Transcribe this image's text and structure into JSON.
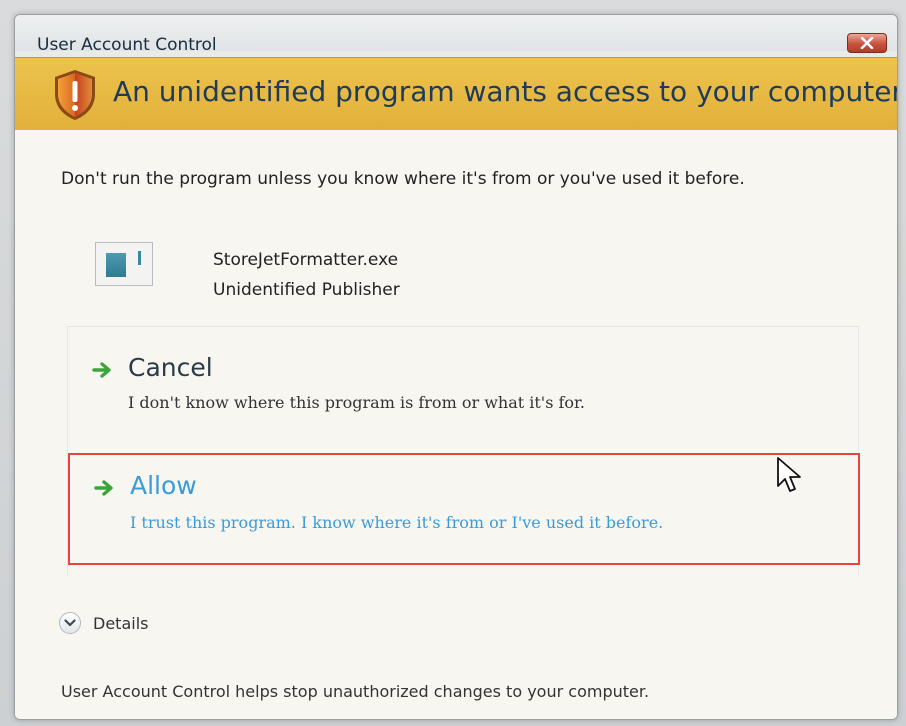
{
  "window": {
    "title": "User Account Control"
  },
  "banner": {
    "heading": "An unidentified program wants access to your computer",
    "icon": "shield-warning-icon"
  },
  "warning": {
    "text": "Don't run the program unless you know where it's from or you've used it before."
  },
  "program": {
    "name": "StoreJetFormatter.exe",
    "publisher": "Unidentified Publisher",
    "icon": "program-icon"
  },
  "options": {
    "cancel": {
      "title": "Cancel",
      "description": "I don't know where this program is from or what it's for."
    },
    "allow": {
      "title": "Allow",
      "description": "I trust this program. I know where it's from or I've used it before."
    }
  },
  "details": {
    "label": "Details"
  },
  "footer": {
    "text": "User Account Control helps stop unauthorized changes to your computer."
  },
  "colors": {
    "banner": "#e2b03a",
    "heading": "#1f3b59",
    "allow_link": "#3a9bd9",
    "highlight_border": "#e8433f",
    "arrow": "#3aa63a",
    "close_button": "#c8523d"
  }
}
